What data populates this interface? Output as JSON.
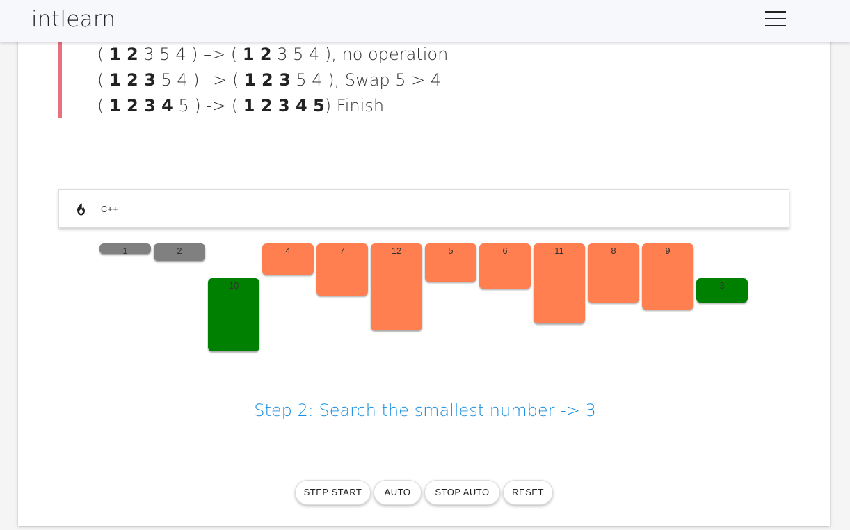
{
  "navbar": {
    "brand": "intlearn",
    "menu_icon": "hamburger-menu-icon"
  },
  "explanation": {
    "lines": [
      {
        "open": "( ",
        "bold1": "1 2",
        "rest1": " 3 5 4 ) –> ( ",
        "bold2": "1 2",
        "rest2": " 3 5 4 ), no operation"
      },
      {
        "open": "( ",
        "bold1": "1 2 3",
        "rest1": " 5 4 ) –> ( ",
        "bold2": "1 2 3",
        "rest2": " 5 4 ), Swap 5 > 4"
      },
      {
        "open": "( ",
        "bold1": "1 2 3 4",
        "rest1": " 5 ) -> ( ",
        "bold2": "1 2 3 4 5",
        "rest2": ") Finish"
      }
    ]
  },
  "language_panel": {
    "icon": "fire-icon",
    "label": "C++"
  },
  "visualization": {
    "colors": {
      "sorted": "#808080",
      "unsorted": "#ff7f50",
      "highlight": "#008000"
    },
    "bars": [
      {
        "value": 1,
        "state": "sorted"
      },
      {
        "value": 2,
        "state": "sorted"
      },
      {
        "value": 10,
        "state": "highlight"
      },
      {
        "value": 4,
        "state": "unsorted"
      },
      {
        "value": 7,
        "state": "unsorted"
      },
      {
        "value": 12,
        "state": "unsorted"
      },
      {
        "value": 5,
        "state": "unsorted"
      },
      {
        "value": 6,
        "state": "unsorted"
      },
      {
        "value": 11,
        "state": "unsorted"
      },
      {
        "value": 8,
        "state": "unsorted"
      },
      {
        "value": 9,
        "state": "unsorted"
      },
      {
        "value": 3,
        "state": "highlight"
      }
    ]
  },
  "status": {
    "step_text": "Step 2: Search the smallest number -> 3"
  },
  "controls": {
    "step_start": "STEP START",
    "auto": "AUTO",
    "stop_auto": "STOP AUTO",
    "reset": "RESET"
  }
}
